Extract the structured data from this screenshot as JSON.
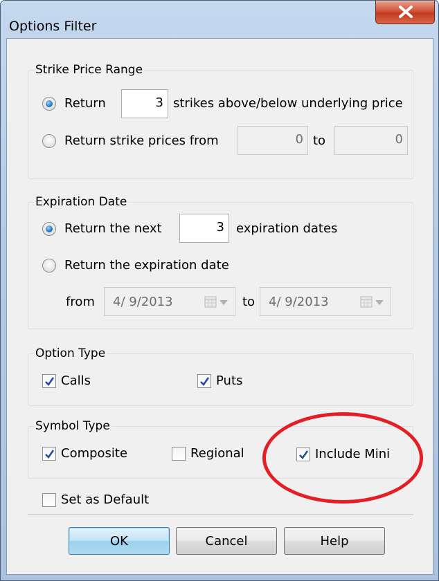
{
  "window": {
    "title": "Options Filter"
  },
  "strike_price_range": {
    "legend": "Strike Price Range",
    "return_label": "Return",
    "return_value": "3",
    "strikes_suffix": "strikes above/below underlying price",
    "range_label": "Return strike prices from",
    "from_value": "0",
    "to_label": "to",
    "to_value": "0",
    "selected": "return"
  },
  "expiration_date": {
    "legend": "Expiration Date",
    "next_label": "Return the next",
    "next_value": "3",
    "next_suffix": "expiration dates",
    "date_label": "Return the expiration date",
    "from_label": "from",
    "from_date": "4/ 9/2013",
    "to_label": "to",
    "to_date": "4/ 9/2013",
    "selected": "next"
  },
  "option_type": {
    "legend": "Option Type",
    "calls_label": "Calls",
    "calls_checked": true,
    "puts_label": "Puts",
    "puts_checked": true
  },
  "symbol_type": {
    "legend": "Symbol Type",
    "composite_label": "Composite",
    "composite_checked": true,
    "regional_label": "Regional",
    "regional_checked": false,
    "mini_label": "Include Mini",
    "mini_checked": true
  },
  "default": {
    "label": "Set as Default",
    "checked": false
  },
  "buttons": {
    "ok": "OK",
    "cancel": "Cancel",
    "help": "Help"
  },
  "colors": {
    "highlight": "#e31e24",
    "check": "#1f4f9a",
    "radio_dot": "#2d7bc8"
  }
}
